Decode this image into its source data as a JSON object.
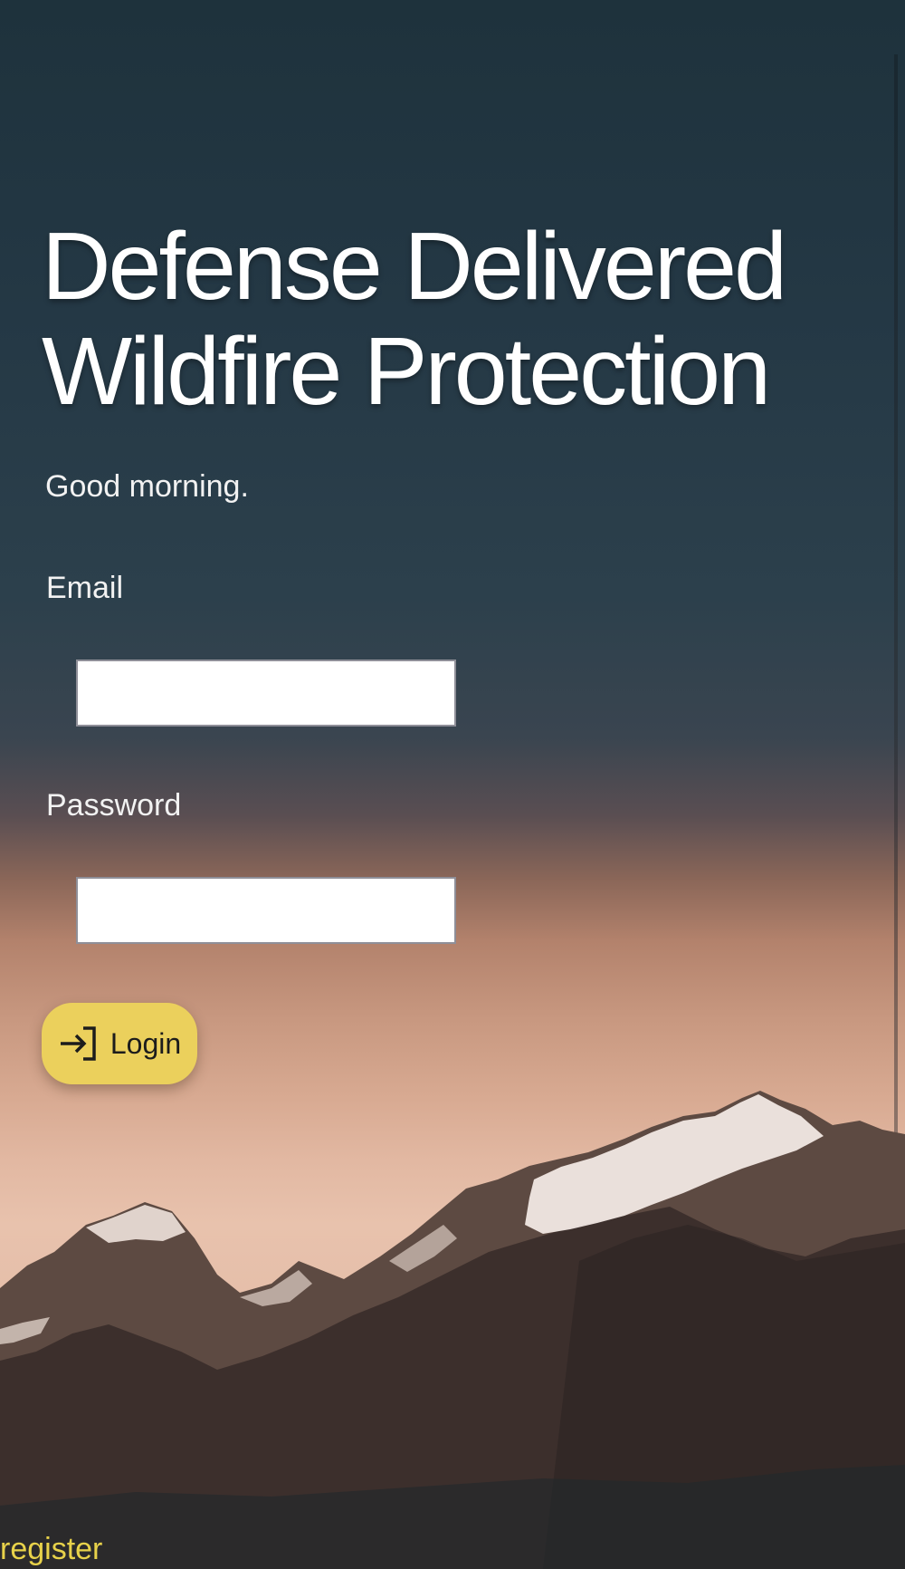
{
  "hero": {
    "title_line1": "Defense Delivered",
    "title_line2": "Wildfire Protection"
  },
  "greeting": "Good morning.",
  "form": {
    "email_label": "Email",
    "email_value": "",
    "password_label": "Password",
    "password_value": ""
  },
  "login_button": {
    "label": "Login",
    "icon": "login-arrow-icon",
    "color": "#ebd05c"
  },
  "register_link": {
    "label": "register",
    "color": "#e8d24a"
  }
}
